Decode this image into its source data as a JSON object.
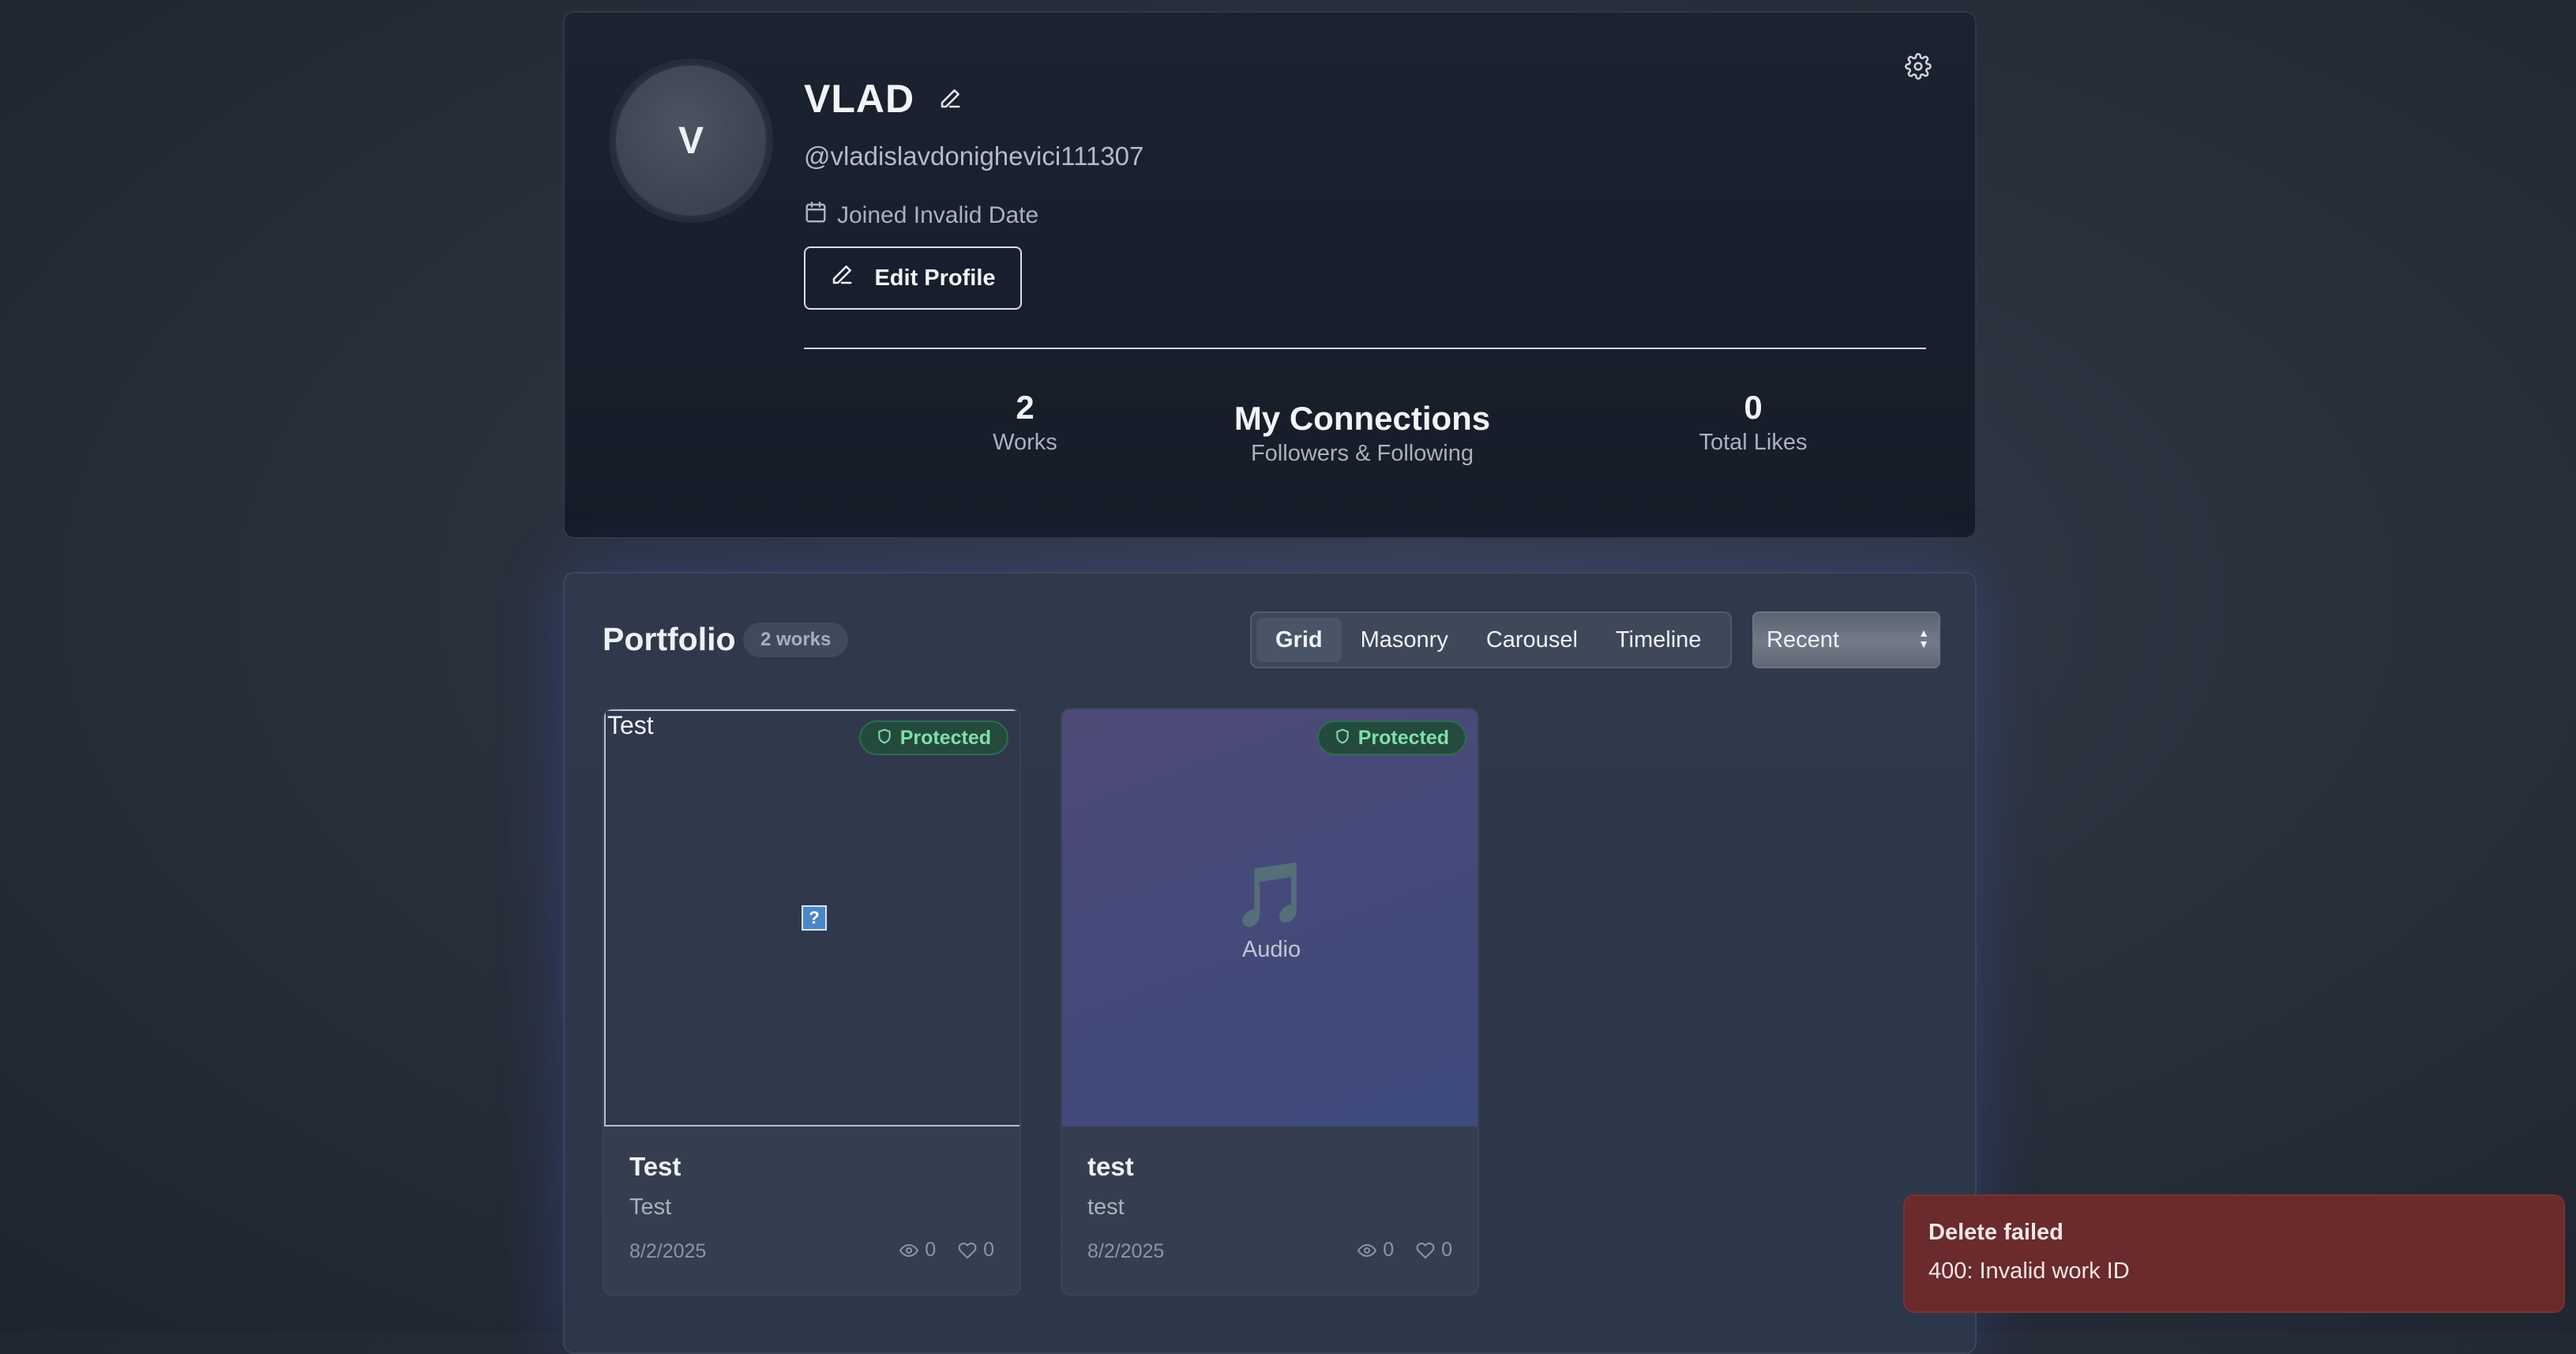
{
  "profile": {
    "avatar_initial": "V",
    "name": "VLAD",
    "handle": "@vladislavdonighevici111307",
    "joined": "Joined Invalid Date",
    "edit_label": "Edit Profile",
    "stats": {
      "works_value": "2",
      "works_label": "Works",
      "connections_title": "My Connections",
      "connections_sub": "Followers & Following",
      "likes_value": "0",
      "likes_label": "Total Likes"
    },
    "icons": {
      "edit_name": "pencil-icon",
      "calendar": "calendar-icon",
      "edit_button": "pencil-icon",
      "settings": "gear-icon"
    }
  },
  "portfolio": {
    "title": "Portfolio",
    "count_badge": "2 works",
    "views": [
      "Grid",
      "Masonry",
      "Carousel",
      "Timeline"
    ],
    "active_view": "Grid",
    "sort_selected": "Recent",
    "works": [
      {
        "type": "image",
        "alt_text": "Test",
        "badge": "Protected",
        "title": "Test",
        "description": "Test",
        "date": "8/2/2025",
        "views": "0",
        "likes": "0"
      },
      {
        "type": "audio",
        "media_label": "Audio",
        "media_glyph": "🎵",
        "badge": "Protected",
        "title": "test",
        "description": "test",
        "date": "8/2/2025",
        "views": "0",
        "likes": "0"
      }
    ]
  },
  "toast": {
    "title": "Delete failed",
    "message": "400: Invalid work ID",
    "color": "#6b2a2c"
  },
  "colors": {
    "background": "#2a313d",
    "protected_badge_text": "#7fe0a8"
  }
}
